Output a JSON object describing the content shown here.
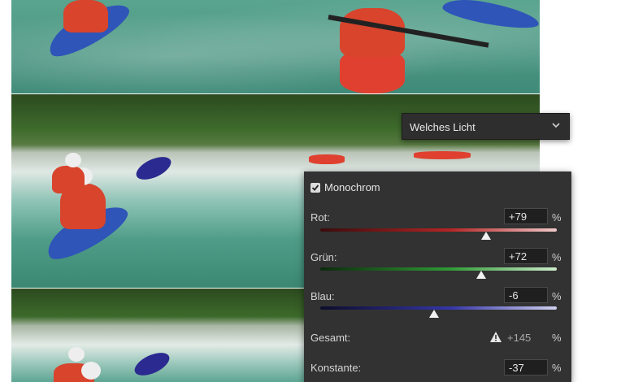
{
  "blend_mode": {
    "selected": "Welches Licht"
  },
  "panel": {
    "monochrome_label": "Monochrom",
    "monochrome_checked": true,
    "channels": [
      {
        "label": "Rot:",
        "value": "+79",
        "unit": "%",
        "slider_fraction": 0.7,
        "color": "#d0352f"
      },
      {
        "label": "Grün:",
        "value": "+72",
        "unit": "%",
        "slider_fraction": 0.68,
        "color": "#3aa845"
      },
      {
        "label": "Blau:",
        "value": "-6",
        "unit": "%",
        "slider_fraction": 0.48,
        "color": "#3d3db0"
      }
    ],
    "total": {
      "label": "Gesamt:",
      "value": "+145",
      "unit": "%",
      "warning_icon": "warning-triangle-icon"
    },
    "constant": {
      "label": "Konstante:",
      "value": "-37",
      "unit": "%"
    }
  }
}
